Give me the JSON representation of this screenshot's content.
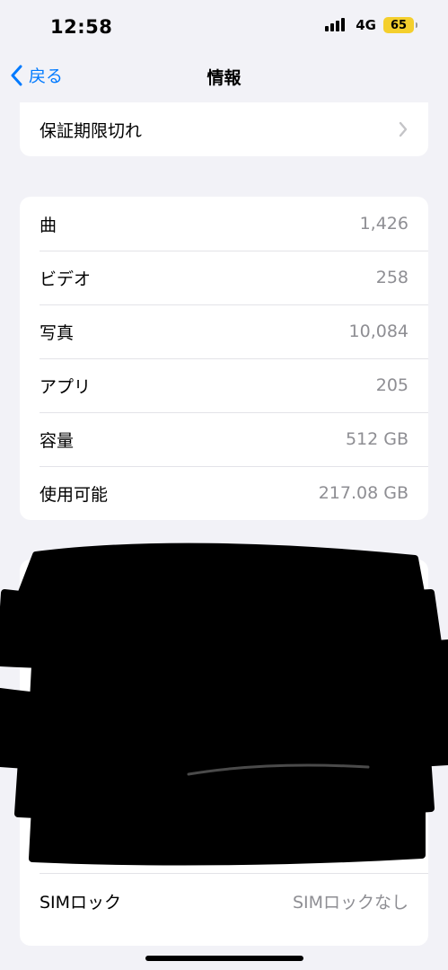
{
  "status_bar": {
    "time": "12:58",
    "network": "4G",
    "battery": "65",
    "battery_color": "#f4cf2d"
  },
  "nav": {
    "back_label": "戻る",
    "title": "情報"
  },
  "warranty": {
    "label": "保証期限切れ"
  },
  "stats": [
    {
      "label": "曲",
      "value": "1,426"
    },
    {
      "label": "ビデオ",
      "value": "258"
    },
    {
      "label": "写真",
      "value": "10,084"
    },
    {
      "label": "アプリ",
      "value": "205"
    },
    {
      "label": "容量",
      "value": "512 GB"
    },
    {
      "label": "使用可能",
      "value": "217.08 GB"
    }
  ],
  "sim": {
    "label": "SIMロック",
    "value": "SIMロックなし"
  },
  "colors": {
    "accent": "#007aff",
    "background": "#f2f2f7",
    "secondary_text": "#8e8e93"
  }
}
